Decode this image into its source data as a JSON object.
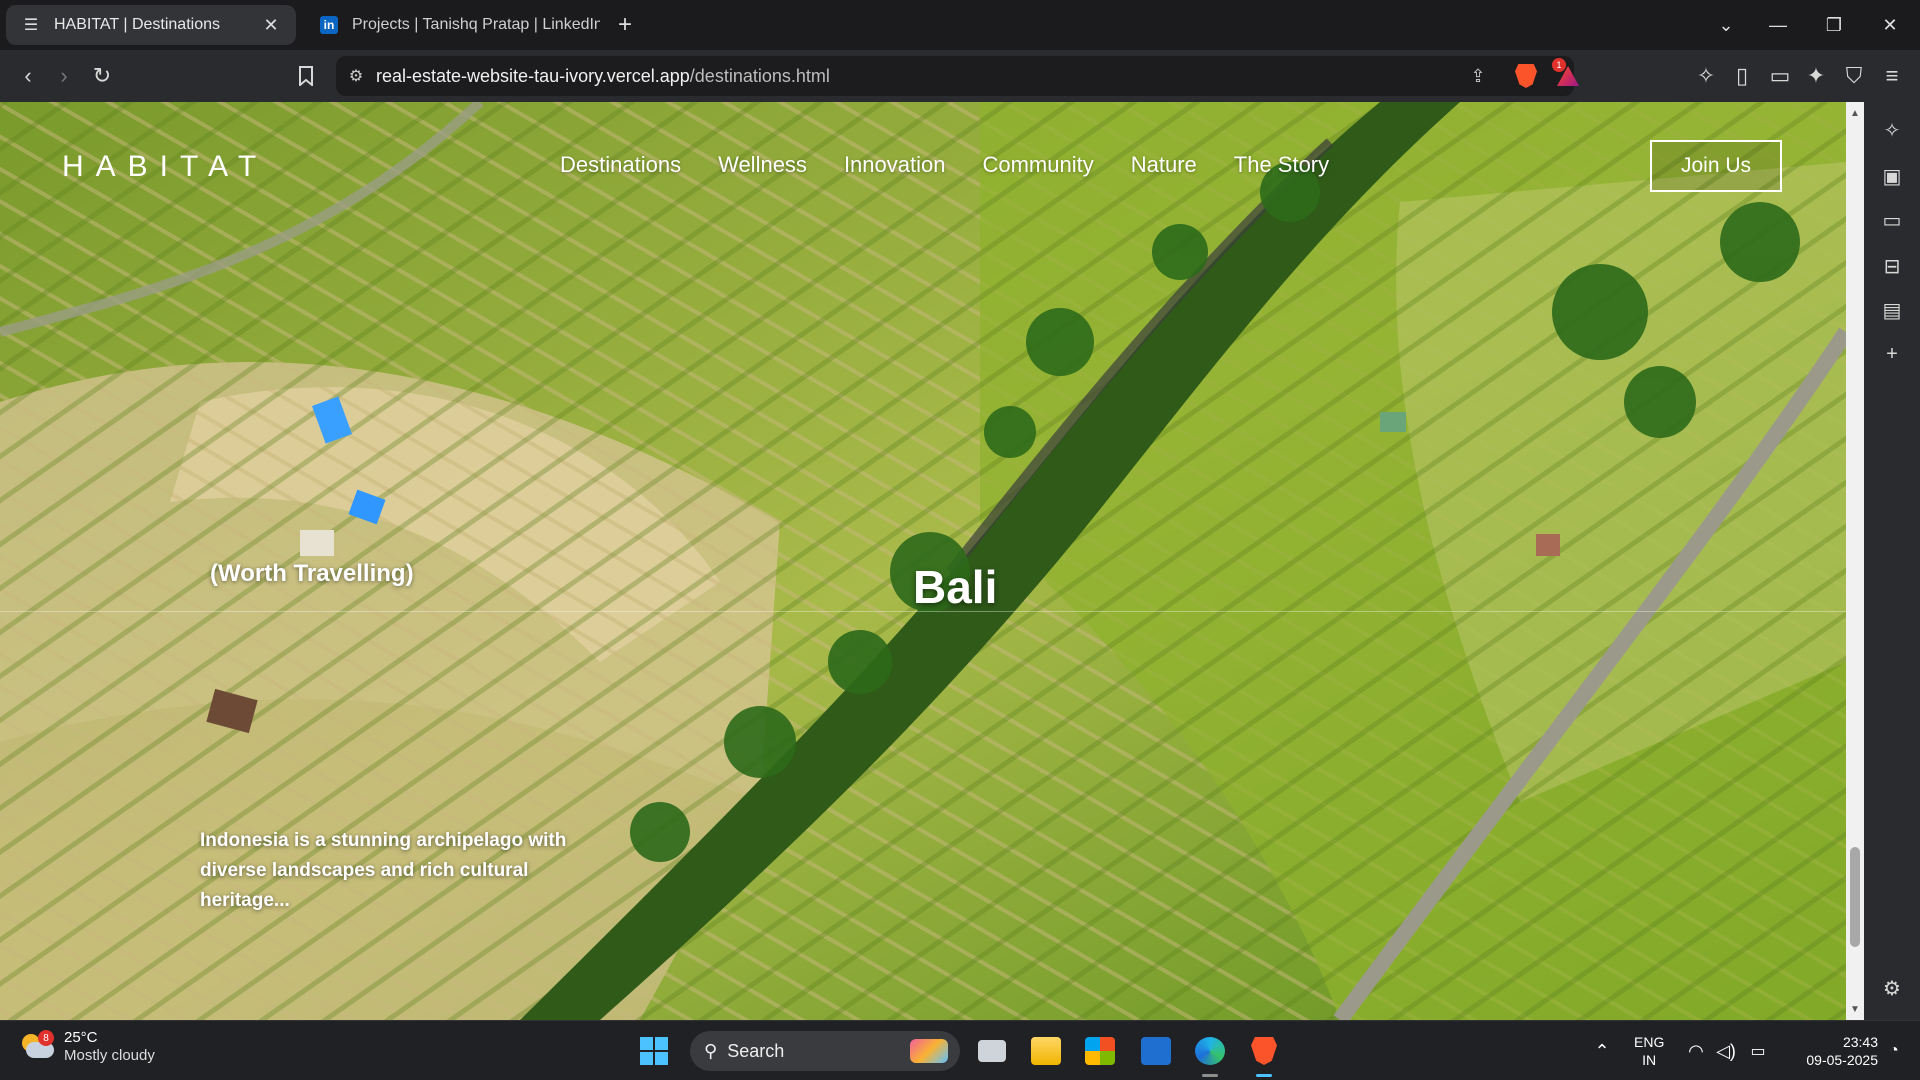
{
  "browser": {
    "tabs": [
      {
        "label": "HABITAT | Destinations",
        "active": true
      },
      {
        "label": "Projects | Tanishq Pratap | LinkedIn",
        "active": false
      }
    ],
    "address": {
      "domain": "real-estate-website-tau-ivory.vercel.app",
      "path": "/destinations.html"
    },
    "rewards_count": "1"
  },
  "site": {
    "logo": "HABITAT",
    "nav": [
      "Destinations",
      "Wellness",
      "Innovation",
      "Community",
      "Nature",
      "The Story"
    ],
    "cta": "Join Us"
  },
  "hero": {
    "tag": "(Worth Travelling)",
    "title": "Bali",
    "description": "Indonesia is a stunning archipelago with diverse landscapes and rich cultural heritage..."
  },
  "taskbar": {
    "weather": {
      "temp": "25°C",
      "condition": "Mostly cloudy",
      "badge": "8"
    },
    "search_label": "Search",
    "lang": {
      "line1": "ENG",
      "line2": "IN"
    },
    "clock": {
      "time": "23:43",
      "date": "09-05-2025"
    }
  },
  "colors": {
    "accent": "#4cc2ff",
    "brave": "#fb542b",
    "linkedin": "#0a66c2"
  }
}
